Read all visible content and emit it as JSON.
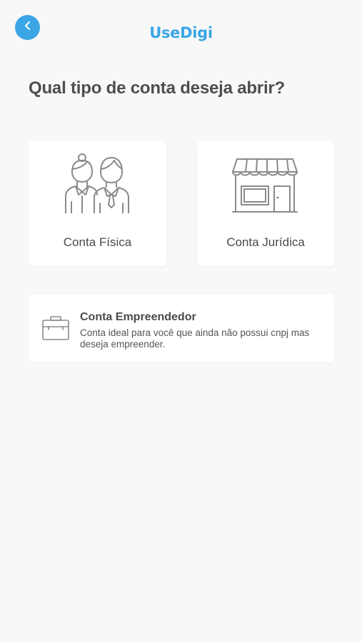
{
  "header": {
    "back_icon": "chevron-left-icon",
    "logo_text": "UseDigi",
    "brand_color": "#3aa6e6"
  },
  "main": {
    "title": "Qual tipo de conta deseja abrir?",
    "options": [
      {
        "label": "Conta Física",
        "icon": "people-icon"
      },
      {
        "label": "Conta Jurídica",
        "icon": "storefront-icon"
      }
    ],
    "empreendedor": {
      "title": "Conta Empreendedor",
      "description": "Conta ideal para você que ainda não possui cnpj mas deseja empreender.",
      "icon": "briefcase-icon"
    }
  }
}
